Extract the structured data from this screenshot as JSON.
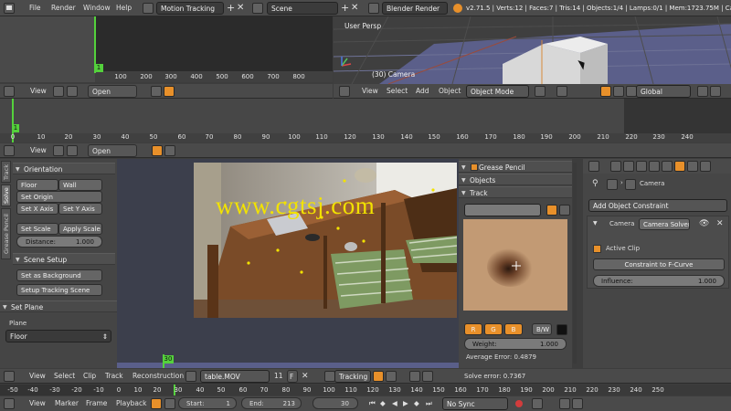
{
  "top_menu": {
    "items": [
      "File",
      "Render",
      "Window",
      "Help"
    ],
    "screen_layout": "Motion Tracking",
    "scene": "Scene",
    "engine": "Blender Render",
    "stats": "v2.71.5 | Verts:12 | Faces:7 | Tris:14 | Objects:1/4 | Lamps:0/1 | Mem:1723.75M | Cam"
  },
  "graph_editor": {
    "ticks": [
      "100",
      "200",
      "300",
      "400",
      "500",
      "600",
      "700",
      "800"
    ],
    "frame_marker": "1",
    "header": {
      "view": "View",
      "open": "Open"
    }
  },
  "viewport": {
    "title": "User Persp",
    "object_label": "(30) Camera",
    "header": {
      "view": "View",
      "select": "Select",
      "add": "Add",
      "object": "Object",
      "mode": "Object Mode",
      "orientation": "Global"
    }
  },
  "dopesheet": {
    "ticks": [
      "0",
      "10",
      "20",
      "30",
      "40",
      "50",
      "60",
      "70",
      "80",
      "90",
      "100",
      "110",
      "120",
      "130",
      "140",
      "150",
      "160",
      "170",
      "180",
      "190",
      "200",
      "210",
      "220",
      "230",
      "240"
    ],
    "frame_marker": "1",
    "header": {
      "view": "View",
      "open": "Open"
    }
  },
  "tool_tabs": [
    "Track",
    "Solve",
    "Grease Pencil"
  ],
  "tools": {
    "orientation_title": "Orientation",
    "floor": "Floor",
    "wall": "Wall",
    "set_origin": "Set Origin",
    "set_x_axis": "Set X Axis",
    "set_y_axis": "Set Y Axis",
    "set_scale": "Set Scale",
    "apply_scale": "Apply Scale",
    "distance_label": "Distance:",
    "distance_value": "1.000",
    "scene_setup_title": "Scene Setup",
    "set_background": "Set as Background",
    "setup_tracking_scene": "Setup Tracking Scene"
  },
  "set_plane": {
    "title": "Set Plane",
    "plane_label": "Plane",
    "plane_value": "Floor"
  },
  "clip_view": {
    "watermark": "www.cgtsj.com",
    "frame_marker": "30"
  },
  "track_panel": {
    "grease_pencil": "Grease Pencil",
    "objects": "Objects",
    "track": "Track",
    "channels": [
      "R",
      "G",
      "B"
    ],
    "bw": "B/W",
    "weight_label": "Weight:",
    "weight_value": "1.000",
    "avg_error": "Average Error: 0.4879"
  },
  "properties": {
    "object_name": "Camera",
    "add_constraint": "Add Object Constraint",
    "constraint_type": "Camera",
    "constraint_name": "Camera Solver",
    "active_clip": "Active Clip",
    "active_clip_checked": true,
    "constraint_to_fcurve": "Constraint to F-Curve",
    "influence_label": "Influence:",
    "influence_value": "1.000"
  },
  "clip_header": {
    "view": "View",
    "select": "Select",
    "clip": "Clip",
    "track": "Track",
    "reconstruction": "Reconstruction",
    "clip_name": "table.MOV",
    "users": "11",
    "fake": "F",
    "mode": "Tracking",
    "solve_error": "Solve error: 0.7367"
  },
  "timeline": {
    "ticks": [
      "-50",
      "-40",
      "-30",
      "-20",
      "-10",
      "0",
      "10",
      "20",
      "30",
      "40",
      "50",
      "60",
      "70",
      "80",
      "90",
      "100",
      "110",
      "120",
      "130",
      "140",
      "150",
      "160",
      "170",
      "180",
      "190",
      "200",
      "210",
      "220",
      "230",
      "240",
      "250"
    ],
    "view": "View",
    "marker": "Marker",
    "frame": "Frame",
    "playback": "Playback",
    "start_label": "Start:",
    "start_value": "1",
    "end_label": "End:",
    "end_value": "213",
    "current_frame": "30",
    "sync": "No Sync"
  },
  "colors": {
    "accent": "#e8902a",
    "frame_green": "#54d13c",
    "watermark": "#f2e200",
    "panel": "#474747",
    "header": "#4a4a4a",
    "viewport_floor": "#5b5f8a"
  }
}
